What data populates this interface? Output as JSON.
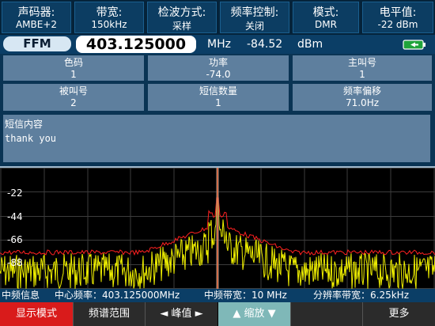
{
  "top_params": [
    {
      "label": "声码器:",
      "value": "AMBE+2"
    },
    {
      "label": "带宽:",
      "value": "150kHz"
    },
    {
      "label": "检波方式:",
      "value": "采样"
    },
    {
      "label": "频率控制:",
      "value": "关闭"
    },
    {
      "label": "模式:",
      "value": "DMR"
    },
    {
      "label": "电平值:",
      "value": "-22 dBm"
    }
  ],
  "freq_row": {
    "mode": "FFM",
    "frequency": "403.125000",
    "frequency_unit": "MHz",
    "level": "-84.52",
    "level_unit": "dBm"
  },
  "info_cells": [
    {
      "label": "色码",
      "value": "1"
    },
    {
      "label": "功率",
      "value": "-74.0"
    },
    {
      "label": "主叫号",
      "value": "1"
    },
    {
      "label": "被叫号",
      "value": "2"
    },
    {
      "label": "短信数量",
      "value": "1"
    },
    {
      "label": "频率偏移",
      "value": "71.0Hz"
    }
  ],
  "sms": {
    "label": "短信内容",
    "content": "thank  you"
  },
  "spectrum": {
    "y_ticks": [
      "-22",
      "-44",
      "-66",
      "-88"
    ],
    "trace_colors": {
      "live": "#f0f000",
      "max_hold": "#ff2020",
      "marker": "#ff7a4a"
    }
  },
  "if_info": {
    "title": "中频信息",
    "center_freq": "中心频率：403.125000MHz",
    "if_bandwidth": "中频带宽：10 MHz",
    "rbw": "分辨率带宽：6.25kHz"
  },
  "softkeys": {
    "display_mode": "显示模式",
    "span": "频谱范围",
    "peak": "◄ 峰值 ►",
    "zoom": "▲ 缩放 ▼",
    "more": "更多"
  },
  "colors": {
    "accent_red": "#d91b1b",
    "panel_blue": "#0c3d62",
    "cell_gray_blue": "#5e7f9e"
  }
}
